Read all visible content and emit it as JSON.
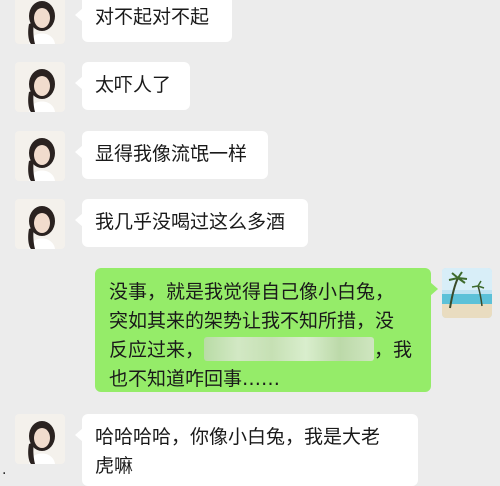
{
  "messages": [
    {
      "side": "left",
      "text": "对不起对不起"
    },
    {
      "side": "left",
      "text": "太吓人了"
    },
    {
      "side": "left",
      "text": "显得我像流氓一样"
    },
    {
      "side": "left",
      "text": "我几乎没喝过这么多酒"
    },
    {
      "side": "right",
      "line1": "没事，就是我觉得自己像小白兔，",
      "line2": "突如其来的架势让我不知所措，没",
      "line3a": "反应过来，",
      "line3b": "，我",
      "line4": "也不知道咋回事……"
    },
    {
      "side": "left",
      "line1": "哈哈哈哈，你像小白兔，我是大老",
      "line2": "虎嘛"
    }
  ],
  "colors": {
    "background": "#ececec",
    "bubble_left": "#ffffff",
    "bubble_right": "#95ec69"
  },
  "icons": {
    "contact_avatar": "girl-avatar-icon",
    "self_avatar": "beach-avatar-icon"
  }
}
